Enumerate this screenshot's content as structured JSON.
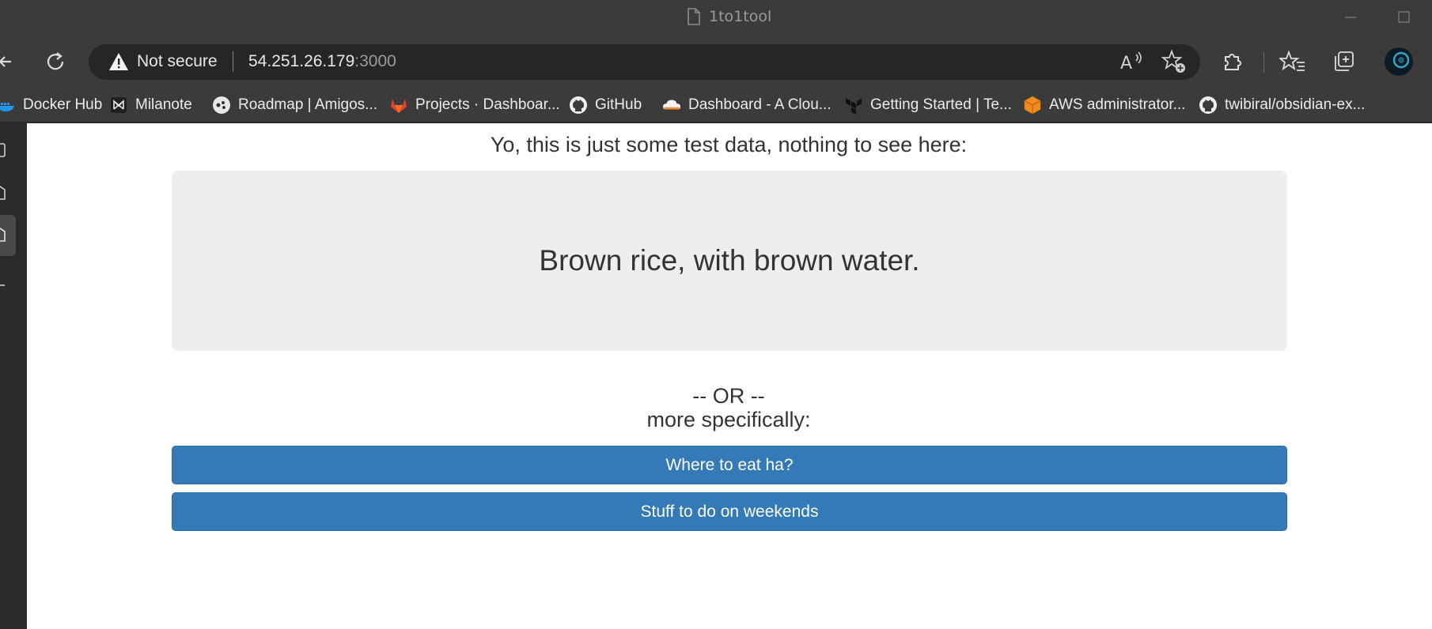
{
  "window": {
    "title": "1to1tool"
  },
  "toolbar": {
    "back_icon": "back-arrow-icon",
    "refresh_icon": "refresh-icon",
    "security_label": "Not secure",
    "url_host": "54.251.26.179",
    "url_port": ":3000",
    "read_aloud_glyph": "A",
    "icons": [
      "read-aloud-icon",
      "add-favorite-icon",
      "extensions-icon",
      "favorites-icon",
      "collections-icon",
      "profile-avatar"
    ]
  },
  "bookmarks": [
    {
      "label": "Docker Hub",
      "icon": "docker-icon"
    },
    {
      "label": "Milanote",
      "icon": "milanote-icon"
    },
    {
      "label": "Roadmap | Amigos...",
      "icon": "roadmap-icon"
    },
    {
      "label": "Projects · Dashboar...",
      "icon": "gitlab-icon"
    },
    {
      "label": "GitHub",
      "icon": "github-icon"
    },
    {
      "label": "Dashboard - A Clou...",
      "icon": "cloud-icon"
    },
    {
      "label": "Getting Started | Te...",
      "icon": "terraform-icon"
    },
    {
      "label": "AWS administrator...",
      "icon": "aws-icon"
    },
    {
      "label": "twibiral/obsidian-ex...",
      "icon": "github-icon"
    }
  ],
  "page": {
    "intro": "Yo, this is just some test data, nothing to see here:",
    "quote": "Brown rice, with brown water.",
    "or_text": "-- OR --",
    "more_text": "more specifically:",
    "buttons": [
      {
        "label": "Where to eat ha?"
      },
      {
        "label": "Stuff to do on weekends"
      }
    ]
  },
  "colors": {
    "button_bg": "#337ab7",
    "well_bg": "#eeeeee",
    "browser_chrome": "#3b3b3b"
  }
}
